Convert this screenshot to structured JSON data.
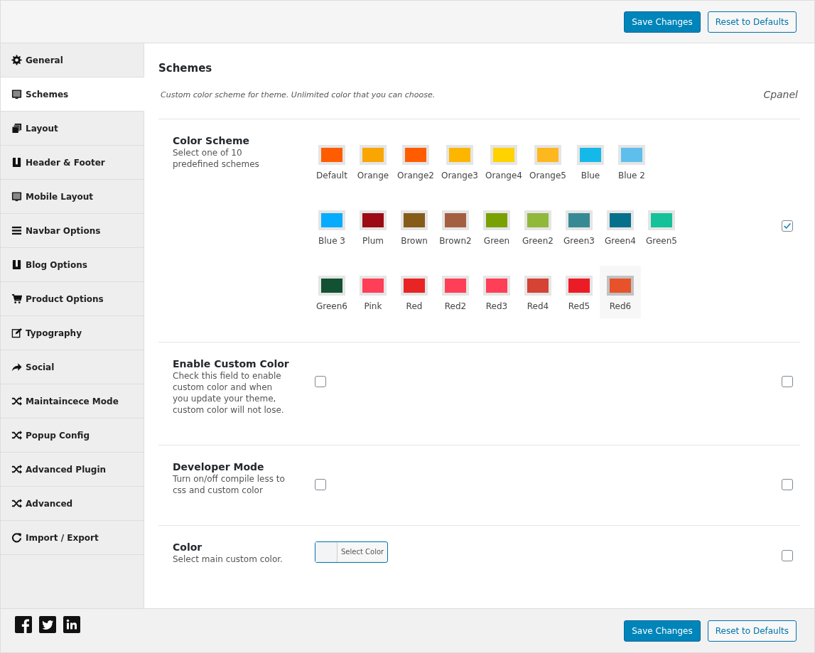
{
  "toolbar": {
    "buttons": [
      {
        "label": "Save Changes",
        "kind": "primary"
      },
      {
        "label": "Reset to Defaults",
        "kind": "secondary"
      }
    ]
  },
  "sidebar": {
    "items": [
      {
        "label": "General",
        "selected": false
      },
      {
        "label": "Schemes",
        "selected": true
      },
      {
        "label": "Layout",
        "selected": false
      },
      {
        "label": "Header & Footer",
        "selected": false
      },
      {
        "label": "Mobile Layout",
        "selected": false
      },
      {
        "label": "Navbar Options",
        "selected": false
      },
      {
        "label": "Blog Options",
        "selected": false
      },
      {
        "label": "Product Options",
        "selected": false
      },
      {
        "label": "Typography",
        "selected": false
      },
      {
        "label": "Social",
        "selected": false
      },
      {
        "label": "Maintaincece Mode",
        "selected": false
      },
      {
        "label": "Popup Config",
        "selected": false
      },
      {
        "label": "Advanced Plugin",
        "selected": false
      },
      {
        "label": "Advanced",
        "selected": false
      },
      {
        "label": "Import / Export",
        "selected": false
      }
    ]
  },
  "section": {
    "title": "Schemes",
    "description": "Custom color scheme for theme. Unlimited color that you can choose.",
    "tag": "Cpanel"
  },
  "fields": [
    {
      "kind": "swatches",
      "title": "Color Scheme",
      "description": "Select one of 10 predefined schemes",
      "side_checked": true,
      "swatch_rows": [
        [
          {
            "label": "Default",
            "color": "#ff5c00",
            "selected": false
          },
          {
            "label": "Orange",
            "color": "#f9a602",
            "selected": false
          },
          {
            "label": "Orange2",
            "color": "#ff5c00",
            "selected": false
          },
          {
            "label": "Orange3",
            "color": "#fdb600",
            "selected": false
          },
          {
            "label": "Orange4",
            "color": "#ffd200",
            "selected": false
          },
          {
            "label": "Orange5",
            "color": "#fdb71f",
            "selected": false
          },
          {
            "label": "Blue",
            "color": "#14b9e9",
            "selected": false
          },
          {
            "label": "Blue 2",
            "color": "#5fbfec",
            "selected": false
          }
        ],
        [
          {
            "label": "Blue 3",
            "color": "#07acff",
            "selected": false
          },
          {
            "label": "Plum",
            "color": "#9c0b13",
            "selected": false
          },
          {
            "label": "Brown",
            "color": "#855c19",
            "selected": false
          },
          {
            "label": "Brown2",
            "color": "#a45f41",
            "selected": false
          },
          {
            "label": "Green",
            "color": "#7aa104",
            "selected": false
          },
          {
            "label": "Green2",
            "color": "#91b83a",
            "selected": false
          },
          {
            "label": "Green3",
            "color": "#378a93",
            "selected": false
          },
          {
            "label": "Green4",
            "color": "#04708c",
            "selected": false
          },
          {
            "label": "Green5",
            "color": "#15c199",
            "selected": false
          }
        ],
        [
          {
            "label": "Green6",
            "color": "#125232",
            "selected": false
          },
          {
            "label": "Pink",
            "color": "#ff3f57",
            "selected": false
          },
          {
            "label": "Red",
            "color": "#e82424",
            "selected": false
          },
          {
            "label": "Red2",
            "color": "#ff3f57",
            "selected": false
          },
          {
            "label": "Red3",
            "color": "#ff3f57",
            "selected": false
          },
          {
            "label": "Red4",
            "color": "#d44334",
            "selected": false
          },
          {
            "label": "Red5",
            "color": "#ec1c27",
            "selected": false
          },
          {
            "label": "Red6",
            "color": "#e8522a",
            "selected": true
          }
        ]
      ]
    },
    {
      "kind": "checkbox",
      "title": "Enable Custom Color",
      "description": "Check this field to enable custom color and when you update your theme, custom color will not lose.",
      "checked": false,
      "side_checked": false
    },
    {
      "kind": "checkbox",
      "title": "Developer Mode",
      "description": "Turn on/off compile less to css and custom color",
      "checked": false,
      "side_checked": false
    },
    {
      "kind": "color",
      "title": "Color",
      "description": "Select main custom color.",
      "button": "Select Color",
      "side_checked": false
    }
  ],
  "footer": {
    "buttons": [
      {
        "label": "Save Changes",
        "kind": "primary"
      },
      {
        "label": "Reset to Defaults",
        "kind": "secondary"
      }
    ]
  }
}
